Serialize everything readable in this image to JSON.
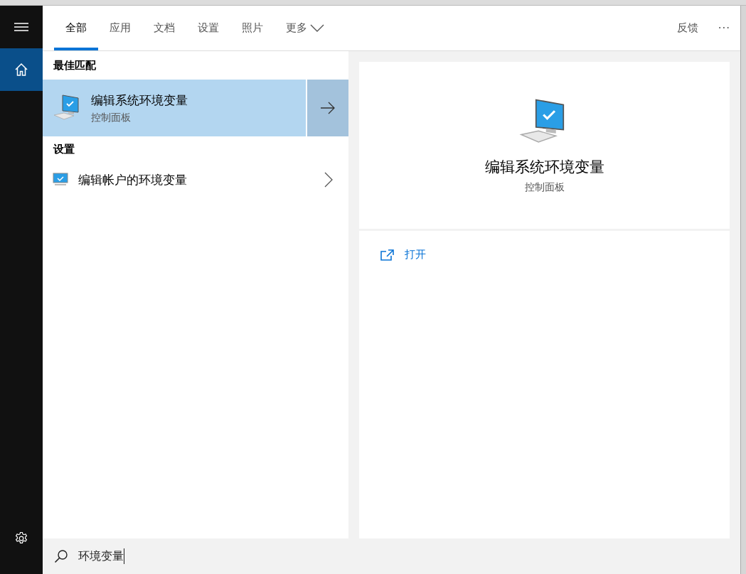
{
  "sidebar": {
    "items": [
      {
        "kind": "menu",
        "selected": false
      },
      {
        "kind": "home",
        "selected": true
      }
    ],
    "bottom": [
      {
        "kind": "settings",
        "selected": false
      }
    ]
  },
  "tabs": [
    {
      "label": "全部",
      "selected": true
    },
    {
      "label": "应用",
      "selected": false
    },
    {
      "label": "文档",
      "selected": false
    },
    {
      "label": "设置",
      "selected": false
    },
    {
      "label": "照片",
      "selected": false
    },
    {
      "label": "更多",
      "selected": false,
      "dropdown": true
    }
  ],
  "feedback": "反馈",
  "more_button": "···",
  "sections": [
    {
      "heading": "最佳匹配",
      "results": [
        {
          "title": "编辑系统环境变量",
          "subtitle": "控制面板",
          "selected": true,
          "kind": "large"
        }
      ]
    },
    {
      "heading": "设置",
      "results": [
        {
          "title": "编辑帐户的环境变量",
          "selected": false,
          "kind": "small"
        }
      ]
    }
  ],
  "preview": {
    "title": "编辑系统环境变量",
    "subtitle": "控制面板",
    "actions": [
      {
        "label": "打开",
        "kind": "open"
      }
    ]
  },
  "search": {
    "value": "环境变量"
  }
}
